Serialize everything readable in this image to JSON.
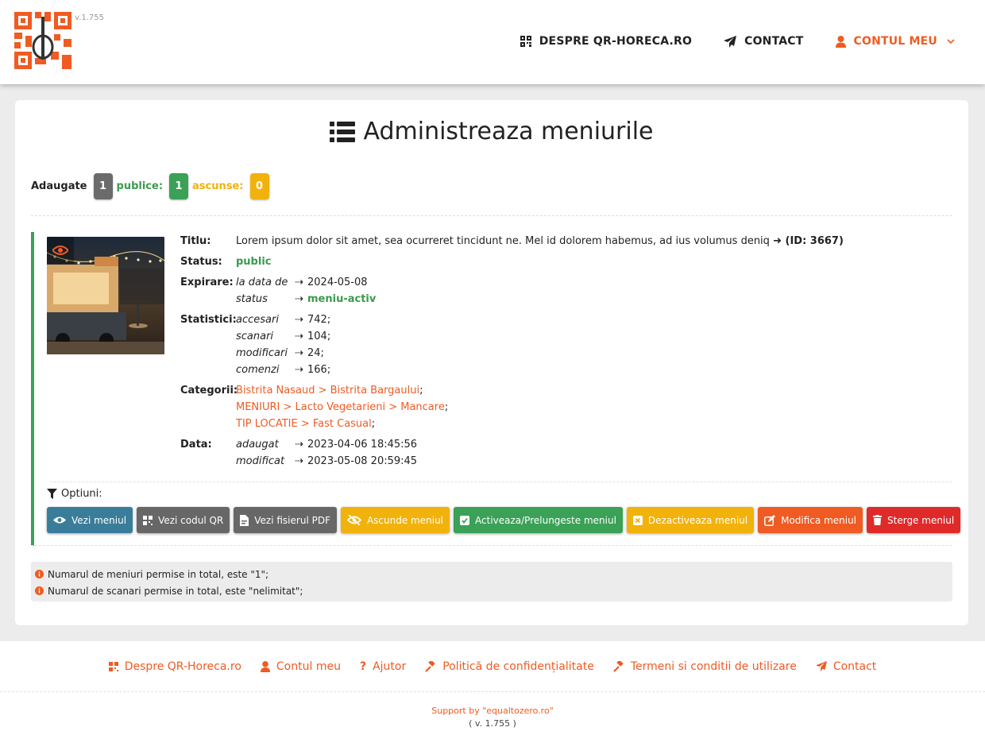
{
  "header": {
    "version": "v.1.755",
    "nav": {
      "about": "DESPRE QR-HORECA.RO",
      "contact": "CONTACT",
      "account": "CONTUL MEU"
    }
  },
  "page": {
    "title": "Administreaza meniurile",
    "counts": {
      "added_label": "Adaugate",
      "added_value": "1",
      "public_label": "publice:",
      "public_value": "1",
      "hidden_label": "ascunse:",
      "hidden_value": "0"
    }
  },
  "menu": {
    "title_label": "Titlu:",
    "title_value": "Lorem ipsum dolor sit amet, sea ocurreret tincidunt ne. Mel id dolorem habemus, ad ius volumus deniq",
    "id_text": "➜ (ID: 3667)",
    "status_label": "Status:",
    "status_value": "public",
    "expiry_label": "Expirare:",
    "expiry": [
      {
        "k": "la data de",
        "v": "2024-05-08"
      },
      {
        "k": "status",
        "v": "meniu-activ"
      }
    ],
    "stats_label": "Statistici:",
    "stats": [
      {
        "k": "accesari",
        "v": "742;"
      },
      {
        "k": "scanari",
        "v": "104;"
      },
      {
        "k": "modificari",
        "v": "24;"
      },
      {
        "k": "comenzi",
        "v": "166;"
      }
    ],
    "categories_label": "Categorii:",
    "categories": [
      "Bistrita Nasaud > Bistrita Bargaului",
      "MENIURI > Lacto Vegetarieni > Mancare",
      "TIP LOCATIE > Fast Casual"
    ],
    "date_label": "Data:",
    "dates": [
      {
        "k": "adaugat",
        "v": "2023-04-06 18:45:56"
      },
      {
        "k": "modificat",
        "v": "2023-05-08 20:59:45"
      }
    ],
    "arrow": "⇢",
    "options_label": "Optiuni:",
    "buttons": {
      "view": "Vezi meniul",
      "qr": "Vezi codul QR",
      "pdf": "Vezi fisierul PDF",
      "hide": "Ascunde meniul",
      "activate": "Activeaza/Prelungeste meniul",
      "deactivate": "Dezactiveaza meniul",
      "edit": "Modifica meniul",
      "delete": "Sterge meniul"
    }
  },
  "notes": [
    "Numarul de meniuri permise in total, este \"1\";",
    "Numarul de scanari permise in total, este \"nelimitat\";"
  ],
  "footer": {
    "links": {
      "about": "Despre QR-Horeca.ro",
      "account": "Contul meu",
      "help": "Ajutor",
      "privacy": "Politică de confidențialitate",
      "terms": "Termeni si conditii de utilizare",
      "contact": "Contact"
    },
    "support": "Support by \"equaltozero.ro\"",
    "version": "( v. 1.755 )"
  },
  "colors": {
    "brand_orange": "#ef5b22",
    "green": "#3aa156",
    "yellow": "#f2b20c",
    "teal": "#3a7d9a",
    "red": "#df2a2a"
  }
}
